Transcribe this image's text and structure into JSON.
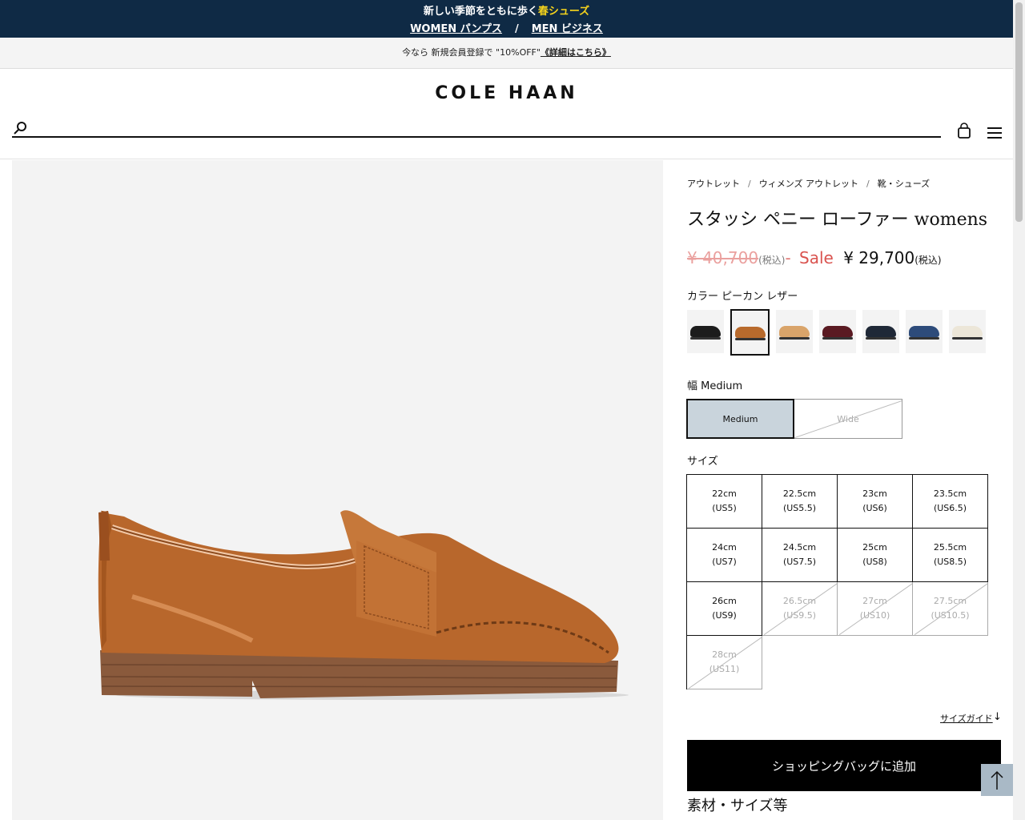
{
  "promo": {
    "line1_prefix": "新しい季節をともに歩く",
    "line1_highlight": "春シューズ",
    "women_link": "WOMEN パンプス",
    "separator": "/",
    "men_link": "MEN ビジネス"
  },
  "member_banner": {
    "text": "今なら 新規会員登録で \"10%OFF\"",
    "link": "《詳細はこちら》"
  },
  "header": {
    "logo": "COLE HAAN",
    "search_placeholder": ""
  },
  "breadcrumb": [
    "アウトレット",
    "ウィメンズ アウトレット",
    "靴・シューズ"
  ],
  "product": {
    "title": "スタッシ ペニー ローファー womens",
    "original_price": "¥ 40,700",
    "original_tax": "(税込)",
    "dash": "-",
    "sale_label": "Sale",
    "sale_price": "¥ 29,700",
    "sale_tax": "(税込)",
    "color_label": "カラー ピーカン レザー",
    "swatches": [
      {
        "name": "black",
        "color": "#1c1c1c",
        "selected": false
      },
      {
        "name": "pecan",
        "color": "#b86a2c",
        "selected": true
      },
      {
        "name": "tan",
        "color": "#d9a46a",
        "selected": false
      },
      {
        "name": "burgundy",
        "color": "#5a1a22",
        "selected": false
      },
      {
        "name": "navy",
        "color": "#1f2837",
        "selected": false
      },
      {
        "name": "blue",
        "color": "#2d4b7a",
        "selected": false
      },
      {
        "name": "ivory",
        "color": "#ece6d8",
        "selected": false
      }
    ],
    "width_label": "幅 Medium",
    "widths": [
      {
        "label": "Medium",
        "selected": true,
        "available": true
      },
      {
        "label": "Wide",
        "selected": false,
        "available": false
      }
    ],
    "size_label": "サイズ",
    "sizes": [
      {
        "cm": "22cm",
        "us": "(US5)",
        "available": true
      },
      {
        "cm": "22.5cm",
        "us": "(US5.5)",
        "available": true
      },
      {
        "cm": "23cm",
        "us": "(US6)",
        "available": true
      },
      {
        "cm": "23.5cm",
        "us": "(US6.5)",
        "available": true
      },
      {
        "cm": "24cm",
        "us": "(US7)",
        "available": true
      },
      {
        "cm": "24.5cm",
        "us": "(US7.5)",
        "available": true
      },
      {
        "cm": "25cm",
        "us": "(US8)",
        "available": true
      },
      {
        "cm": "25.5cm",
        "us": "(US8.5)",
        "available": true
      },
      {
        "cm": "26cm",
        "us": "(US9)",
        "available": true
      },
      {
        "cm": "26.5cm",
        "us": "(US9.5)",
        "available": false
      },
      {
        "cm": "27cm",
        "us": "(US10)",
        "available": false
      },
      {
        "cm": "27.5cm",
        "us": "(US10.5)",
        "available": false
      },
      {
        "cm": "28cm",
        "us": "(US11)",
        "available": false
      }
    ],
    "size_guide": "サイズガイド",
    "size_guide_arrow": "↓",
    "add_to_bag": "ショッピングバッグに追加",
    "materials_heading": "素材・サイズ等"
  },
  "colors": {
    "promo_bg": "#0f2a45",
    "highlight": "#f5d31c",
    "sale_red": "#d9534f",
    "selected_width_bg": "#c9d4dc",
    "top_button_bg": "#a9b9c6"
  }
}
